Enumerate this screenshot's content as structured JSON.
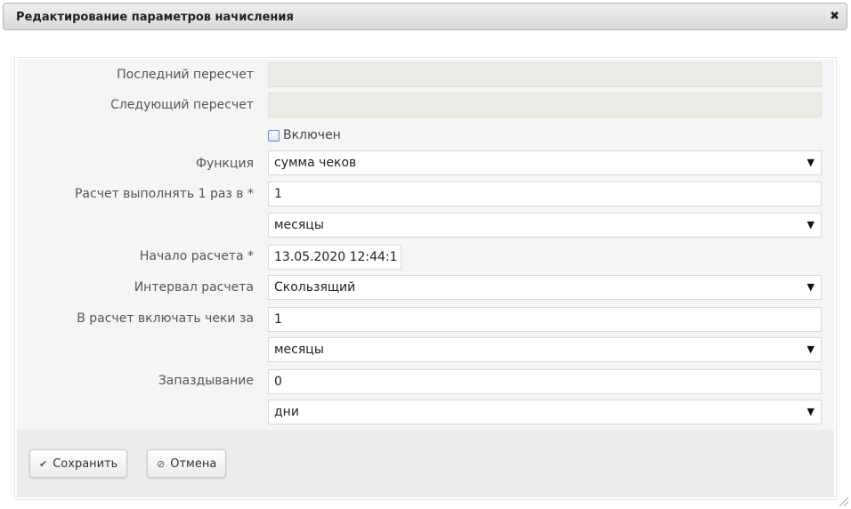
{
  "dialog": {
    "title": "Редактирование параметров начисления",
    "close_glyph": "✖"
  },
  "form": {
    "last_recalc_label": "Последний пересчет",
    "last_recalc_value": "",
    "next_recalc_label": "Следующий пересчет",
    "next_recalc_value": "",
    "enabled_label": "Включен",
    "enabled_checked": false,
    "function_label": "Функция",
    "function_value": "сумма чеков",
    "run_every_label": "Расчет выполнять 1 раз в *",
    "run_every_value": "1",
    "run_every_unit": "месяцы",
    "start_label": "Начало расчета *",
    "start_value": "13.05.2020 12:44:1",
    "interval_label": "Интервал расчета",
    "interval_value": "Скользящий",
    "include_label": "В расчет включать чеки за",
    "include_value": "1",
    "include_unit": "месяцы",
    "delay_label": "Запаздывание",
    "delay_value": "0",
    "delay_unit": "дни"
  },
  "buttons": {
    "save_label": "Сохранить",
    "save_icon": "✔",
    "cancel_label": "Отмена",
    "cancel_icon": "⊘"
  },
  "icons": {
    "dropdown_arrow": "▼"
  }
}
